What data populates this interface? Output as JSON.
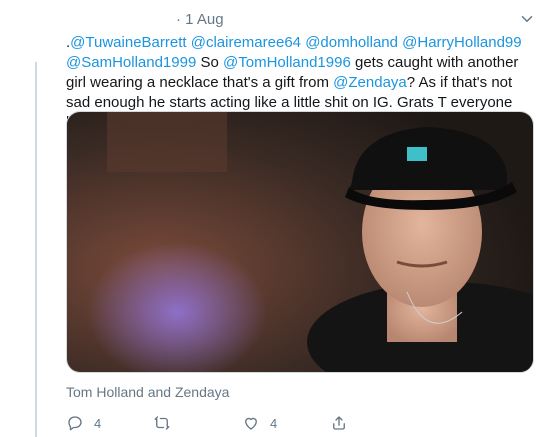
{
  "tweet": {
    "meta": "· 1 Aug",
    "text_parts": [
      {
        "t": ".",
        "m": false
      },
      {
        "t": "@TuwaineBarrett",
        "m": true
      },
      {
        "t": " ",
        "m": false
      },
      {
        "t": "@clairemaree64",
        "m": true
      },
      {
        "t": " ",
        "m": false
      },
      {
        "t": "@domholland",
        "m": true
      },
      {
        "t": " ",
        "m": false
      },
      {
        "t": "@HarryHolland99",
        "m": true
      },
      {
        "t": " ",
        "m": false
      },
      {
        "t": "@SamHolland1999",
        "m": true
      },
      {
        "t": " So ",
        "m": false
      },
      {
        "t": "@TomHolland1996",
        "m": true
      },
      {
        "t": "  gets caught with another girl wearing a necklace that's a gift from ",
        "m": false
      },
      {
        "t": "@Zendaya",
        "m": true
      },
      {
        "t": "? As if that's not sad enough he starts acting like a little shit on IG. Grats T everyone laughing at u now",
        "m": false
      }
    ],
    "caption": "Tom Holland and Zendaya",
    "actions": {
      "reply_count": "4",
      "retweet_count": "",
      "like_count": "4"
    }
  },
  "colors": {
    "text": "#14171a",
    "mention": "#1b95e0",
    "secondary": "#657786"
  }
}
